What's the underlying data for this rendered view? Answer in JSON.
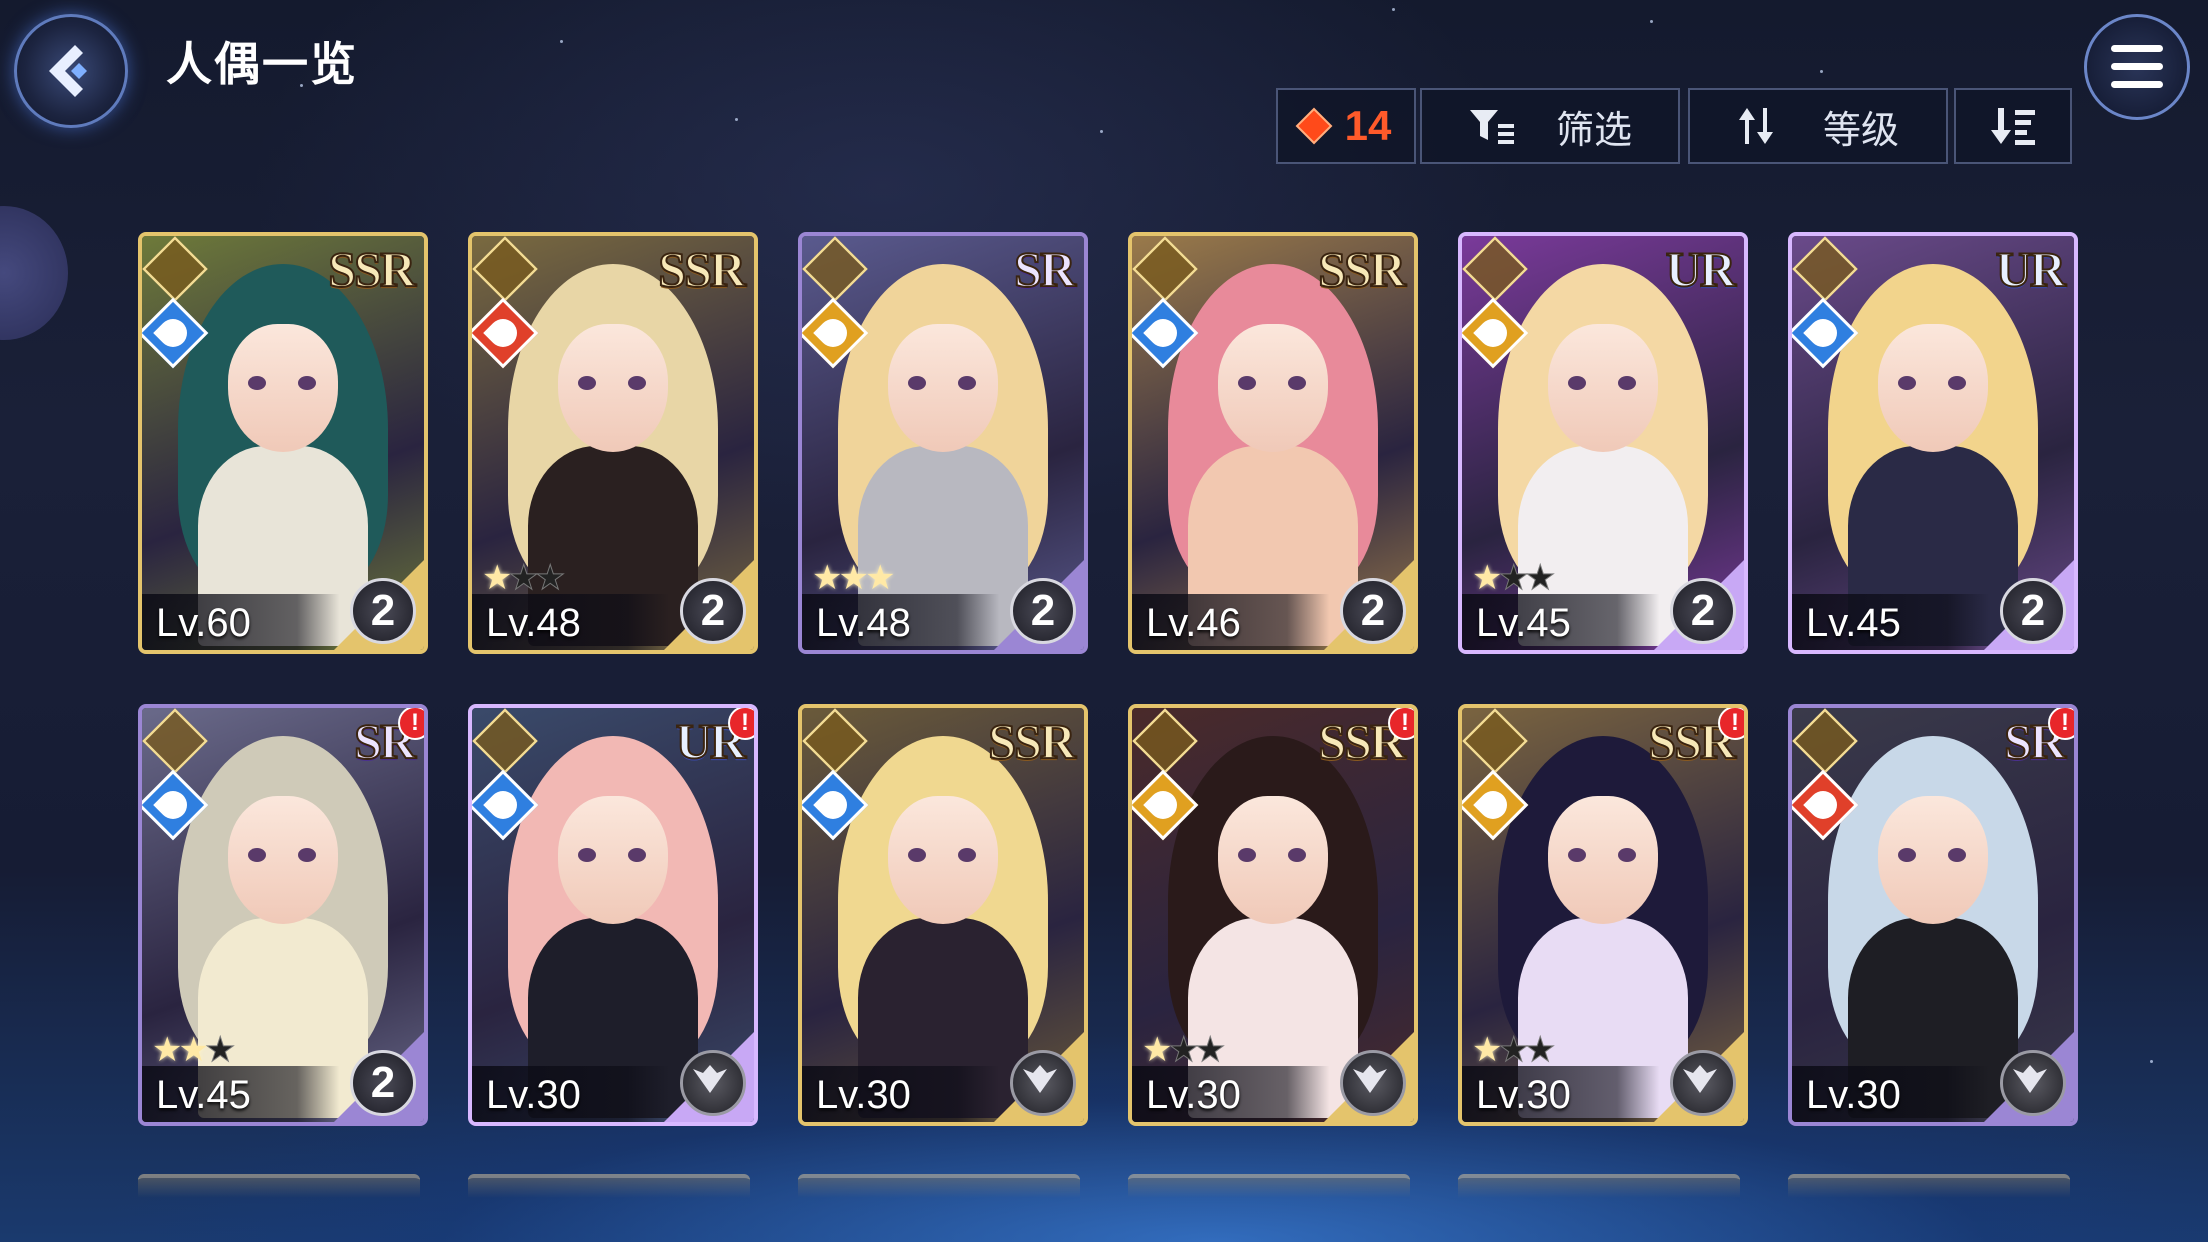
{
  "header": {
    "title": "人偶一览",
    "count": "14",
    "filter_label": "筛选",
    "sort_label": "等级"
  },
  "colors": {
    "ssr_frame": "#e4c46c",
    "sr_frame": "#9b86d4",
    "ur_frame": "#d8b8ff",
    "count_accent": "#ff5a2a"
  },
  "cards": [
    {
      "rarity": "SSR",
      "level": "Lv.60",
      "rank": "2",
      "element": "water",
      "stars": 0,
      "alert": false,
      "hair": "#1f5a5a",
      "outfit": "#e8e4d8",
      "bg": "#6e7a3a"
    },
    {
      "rarity": "SSR",
      "level": "Lv.48",
      "rank": "2",
      "element": "fire",
      "stars": 1,
      "alert": false,
      "hair": "#e8d6a6",
      "outfit": "#2a2020",
      "bg": "#7a6a40"
    },
    {
      "rarity": "SR",
      "level": "Lv.48",
      "rank": "2",
      "element": "light",
      "stars": 3,
      "alert": false,
      "hair": "#f0d49a",
      "outfit": "#b8b8c0",
      "bg": "#5a5a8e"
    },
    {
      "rarity": "SSR",
      "level": "Lv.46",
      "rank": "2",
      "element": "water",
      "stars": 0,
      "alert": false,
      "hair": "#e88a9a",
      "outfit": "#f2c8b0",
      "bg": "#9a7a4a"
    },
    {
      "rarity": "UR",
      "level": "Lv.45",
      "rank": "2",
      "element": "light",
      "stars": 1,
      "alert": false,
      "hair": "#f4d8a4",
      "outfit": "#f2eef0",
      "bg": "#7a3a9a"
    },
    {
      "rarity": "UR",
      "level": "Lv.45",
      "rank": "2",
      "element": "water",
      "stars": 0,
      "alert": false,
      "hair": "#f2d48c",
      "outfit": "#2a2a46",
      "bg": "#6a4a8a"
    },
    {
      "rarity": "SR",
      "level": "Lv.45",
      "rank": "2",
      "element": "water",
      "stars": 2,
      "alert": true,
      "hair": "#cfcab8",
      "outfit": "#f2ead0",
      "bg": "#6a6a8a"
    },
    {
      "rarity": "UR",
      "level": "Lv.30",
      "rank": "",
      "element": "water",
      "stars": 0,
      "alert": true,
      "hair": "#f2b8b4",
      "outfit": "#1e1e2a",
      "bg": "#3a4a6a"
    },
    {
      "rarity": "SSR",
      "level": "Lv.30",
      "rank": "",
      "element": "water",
      "stars": 0,
      "alert": false,
      "hair": "#f0d890",
      "outfit": "#2a2230",
      "bg": "#6a5a3a"
    },
    {
      "rarity": "SSR",
      "level": "Lv.30",
      "rank": "",
      "element": "light",
      "stars": 1,
      "alert": true,
      "hair": "#2a1a1a",
      "outfit": "#f4e4e4",
      "bg": "#4a2a2a"
    },
    {
      "rarity": "SSR",
      "level": "Lv.30",
      "rank": "",
      "element": "light",
      "stars": 1,
      "alert": true,
      "hair": "#1e1a3a",
      "outfit": "#e8dcf4",
      "bg": "#7a6440"
    },
    {
      "rarity": "SR",
      "level": "Lv.30",
      "rank": "",
      "element": "fire",
      "stars": 0,
      "alert": true,
      "hair": "#c8d8e8",
      "outfit": "#1e1e24",
      "bg": "#3a3a4a"
    }
  ]
}
